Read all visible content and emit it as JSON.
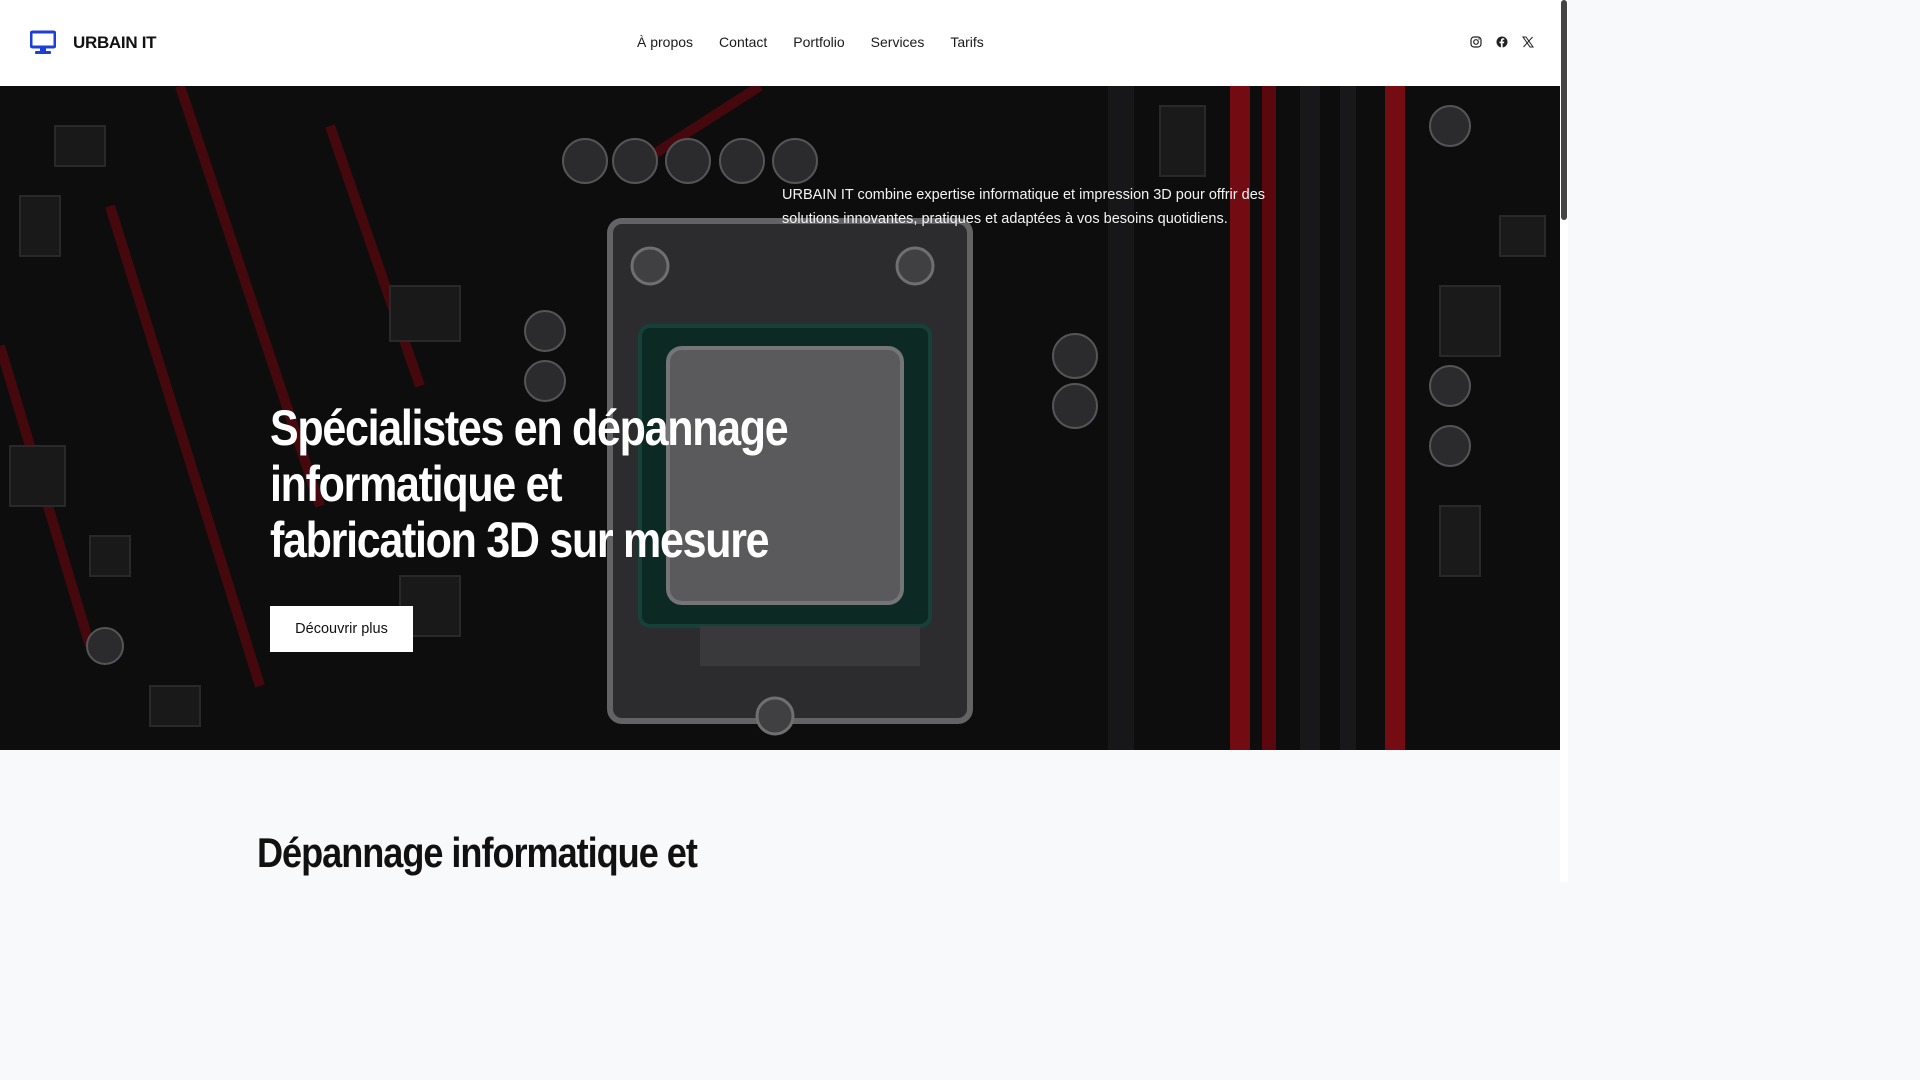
{
  "header": {
    "brand": "URBAIN IT",
    "nav": [
      "À propos",
      "Contact",
      "Portfolio",
      "Services",
      "Tarifs"
    ],
    "social_icons": [
      "instagram-icon",
      "facebook-icon",
      "x-icon"
    ]
  },
  "hero": {
    "intro": "URBAIN IT combine expertise informatique et impression 3D pour offrir des solutions innovantes, pratiques et adaptées à vos besoins quotidiens.",
    "title_lines": [
      "Spécialistes en dépannage",
      "informatique et",
      "fabrication 3D sur mesure"
    ],
    "cta": "Découvrir plus"
  },
  "section": {
    "title": "Dépannage informatique et"
  },
  "colors": {
    "accent": "#1d3fd8",
    "hero_red": "#b3121c",
    "dark": "#0c0c0d"
  }
}
